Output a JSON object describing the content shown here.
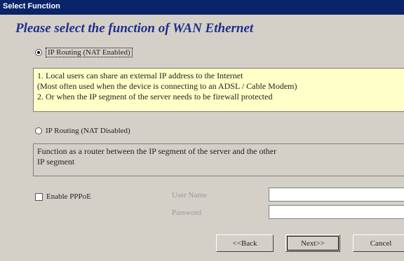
{
  "window": {
    "title": "Select Function"
  },
  "heading": "Please select the function of WAN Ethernet",
  "options": [
    {
      "label": "IP Routing (NAT Enabled)",
      "selected": true,
      "description": [
        "1. Local users can share an external IP address to the Internet",
        "(Most often used when the device is connecting to an ADSL / Cable Modem)",
        "2. Or when the IP segment of the server needs to be firewall protected"
      ]
    },
    {
      "label": "IP Routing (NAT Disabled)",
      "selected": false,
      "description": [
        "Function as a router between the IP segment of the server and the other",
        "IP segment"
      ]
    }
  ],
  "pppoe": {
    "checkbox_label": "Enable PPPoE",
    "checked": false,
    "user_name_label": "User Name",
    "user_name_value": "",
    "password_label": "Password",
    "password_value": ""
  },
  "buttons": {
    "back": "<<Back",
    "next": "Next>>",
    "cancel": "Cancel"
  }
}
